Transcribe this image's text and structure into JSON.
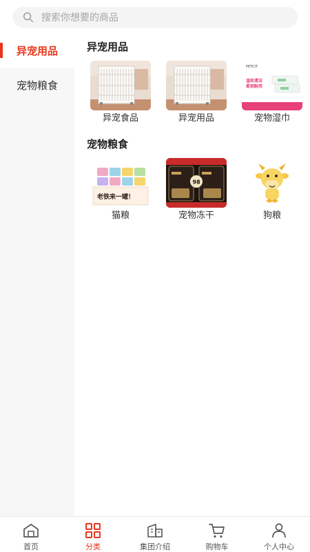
{
  "search": {
    "placeholder": "搜索你想要的商品"
  },
  "sidebar": {
    "items": [
      {
        "label": "异宠用品",
        "active": true
      },
      {
        "label": "宠物粮食",
        "active": false
      }
    ]
  },
  "sections": [
    {
      "title": "异宠用品",
      "items": [
        {
          "label": "异宠食品",
          "image": "pet-cage-photo"
        },
        {
          "label": "异宠用品",
          "image": "pet-cage-photo"
        },
        {
          "label": "宠物湿巾",
          "image": "pet-wipes-photo",
          "image_text": [
            "PETCIT",
            "温和清洁",
            "柔韧耐用"
          ]
        }
      ]
    },
    {
      "title": "宠物粮食",
      "items": [
        {
          "label": "猫粮",
          "image": "cat-cans-photo",
          "image_text": [
            "老铁来一罐！"
          ]
        },
        {
          "label": "宠物冻干",
          "image": "freeze-dried-photo",
          "image_text": [
            "98"
          ]
        },
        {
          "label": "狗粮",
          "image": "cartoon-calf-mascot"
        }
      ]
    }
  ],
  "tabbar": {
    "items": [
      {
        "label": "首页",
        "icon": "home-icon",
        "active": false
      },
      {
        "label": "分类",
        "icon": "category-grid-icon",
        "active": true
      },
      {
        "label": "集团介绍",
        "icon": "building-icon",
        "active": false
      },
      {
        "label": "购物车",
        "icon": "cart-icon",
        "active": false
      },
      {
        "label": "个人中心",
        "icon": "person-icon",
        "active": false
      }
    ]
  },
  "colors": {
    "accent": "#e8361a",
    "sidebar_bg": "#f7f7f7",
    "search_bg": "#f4f4f4"
  }
}
